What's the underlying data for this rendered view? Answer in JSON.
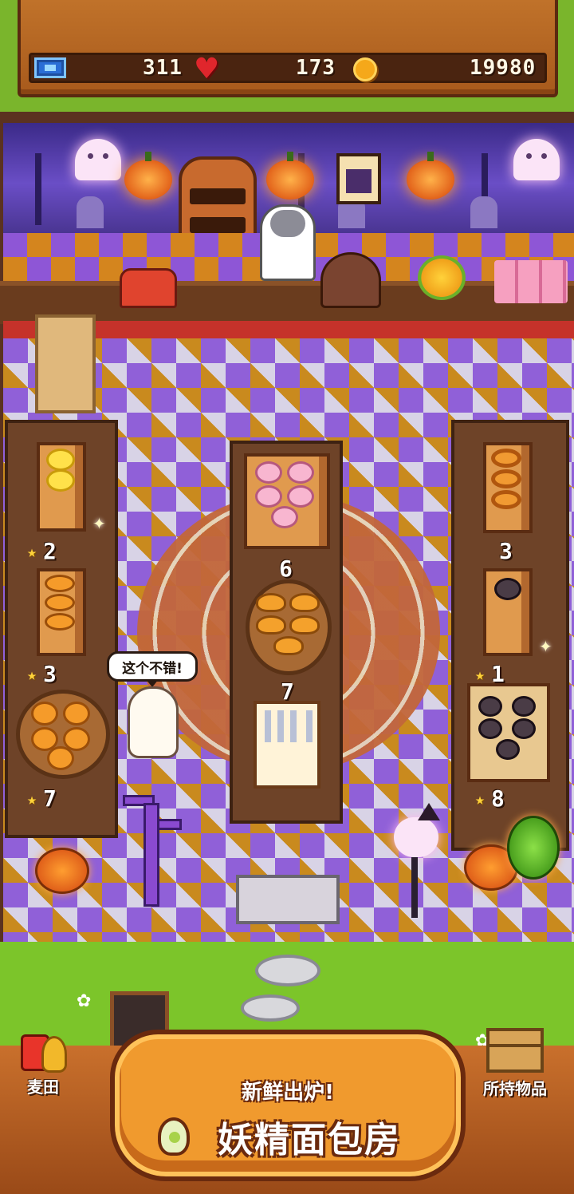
{
  "resources": {
    "tickets": "311",
    "hearts": "173",
    "coins": "19980"
  },
  "shelves": {
    "left_top_price": "2",
    "left_middle_price": "3",
    "left_bottom_price": "7",
    "center_top_price": "6",
    "center_middle_price": "7",
    "right_top_price": "3",
    "right_middle_price": "1",
    "right_bottom_price": "8"
  },
  "customer": {
    "speech": "这个不错!"
  },
  "nav": {
    "wheat_field_label": "麦田",
    "inventory_label": "所持物品"
  },
  "sign": {
    "subtitle": "新鲜出炉!",
    "title": "妖精面包房"
  },
  "icons": {
    "ticket": "ticket-icon",
    "heart": "heart-icon",
    "coin": "coin-icon",
    "star": "star-icon",
    "wheat": "wheat-icon",
    "box": "box-icon"
  },
  "colors": {
    "wall": "#5b3fb0",
    "floor_orange": "#c98a1e",
    "floor_purple": "#9060d8",
    "grass": "#7cc52a",
    "sign": "#f09a2e"
  }
}
